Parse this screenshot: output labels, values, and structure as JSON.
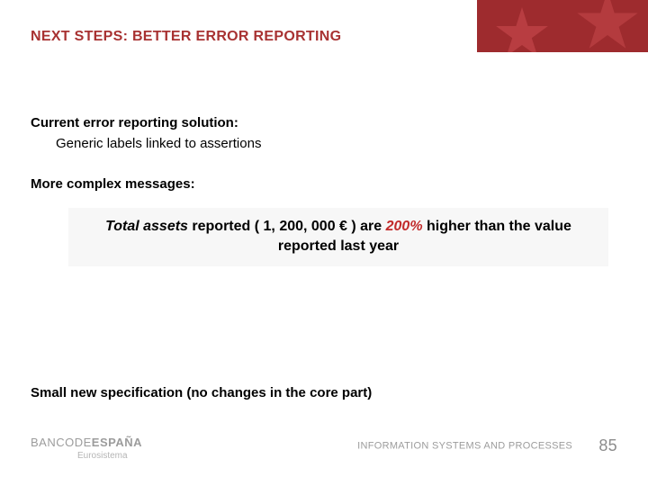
{
  "title": "NEXT STEPS: BETTER ERROR REPORTING",
  "section1": {
    "heading": "Current error reporting solution:",
    "sub": "Generic labels linked to assertions"
  },
  "section2": {
    "heading": "More complex messages:",
    "msg": {
      "p1": "Total assets ",
      "p2": "reported ( 1, 200, 000 € ) are ",
      "p3": "200% ",
      "p4": "higher than the value reported last year"
    }
  },
  "specLine": "Small new specification (no changes in the core part)",
  "footer": {
    "brand1": "BANCODE",
    "brand2": "ESPAÑA",
    "brandSub": "Eurosistema",
    "section": "INFORMATION SYSTEMS AND PROCESSES",
    "page": "85"
  }
}
